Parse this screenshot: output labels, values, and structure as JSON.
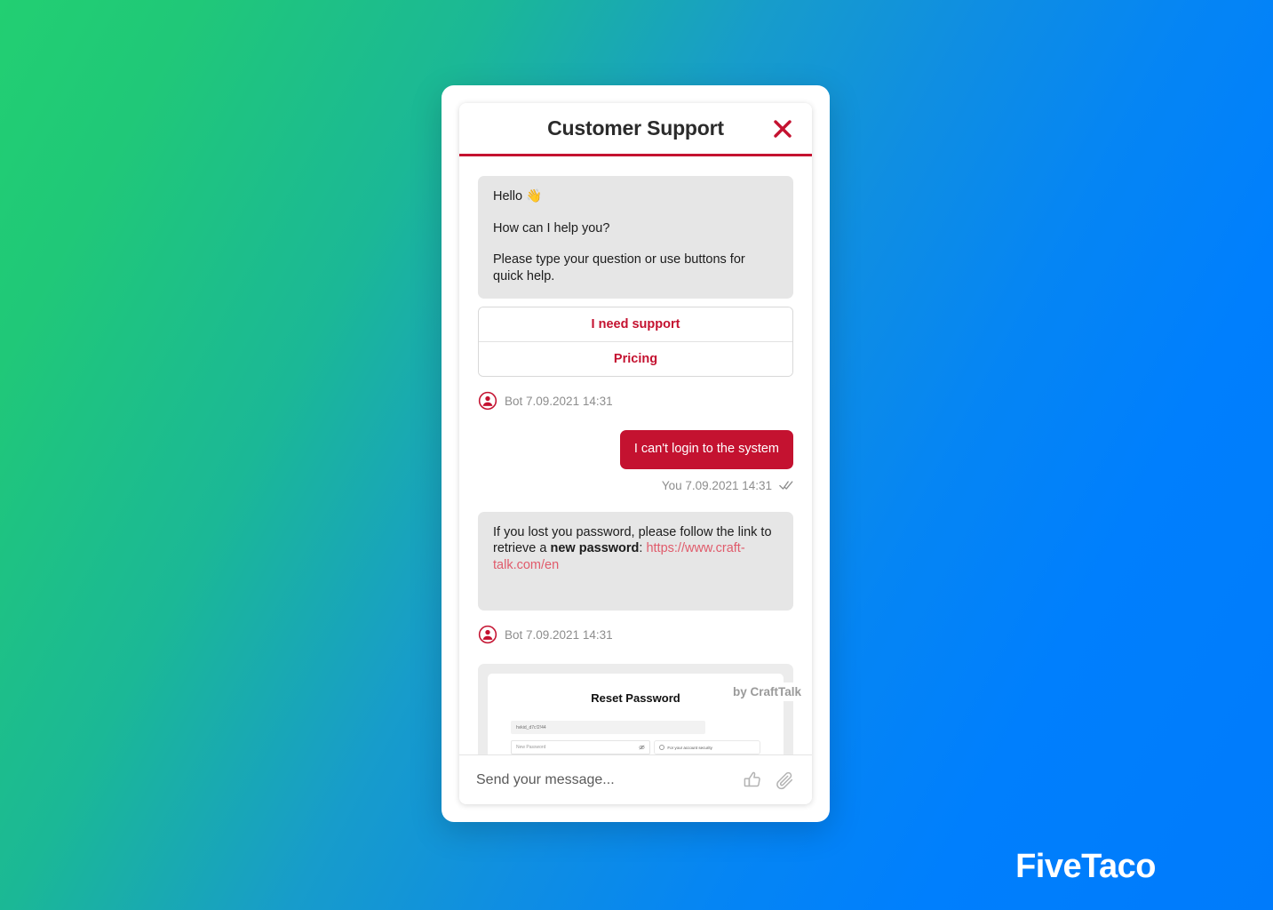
{
  "background": {
    "gradient_start": "#22cf72",
    "gradient_mid": "#179ccb",
    "gradient_end": "#007bfb"
  },
  "brand": {
    "logo_text": "FiveTaco"
  },
  "widget": {
    "accent_color": "#c41230",
    "header": {
      "title": "Customer Support",
      "close_label": "close-icon"
    },
    "messages": [
      {
        "type": "bot",
        "lines": [
          "Hello 👋",
          "How can I help you?",
          "Please type your question or use buttons for quick help."
        ],
        "quick_replies": [
          "I need support",
          "Pricing"
        ],
        "meta": "Bot 7.09.2021 14:31"
      },
      {
        "type": "user",
        "text": "I can't login to the system",
        "meta": "You 7.09.2021 14:31",
        "status": "read"
      },
      {
        "type": "bot",
        "text_before": "If you lost you password, please follow the link to retrieve a ",
        "text_bold": "new password",
        "text_after": ": ",
        "link": "https://www.craft-talk.com/en",
        "meta": "Bot 7.09.2021 14:31"
      }
    ],
    "attachment_preview": {
      "title": "Reset Password",
      "field_value": "hvkid_d7c!2!44",
      "password_placeholder": "New Password",
      "tooltip": "For your account security"
    },
    "vendor_label": "by CraftTalk",
    "composer": {
      "placeholder": "Send your message...",
      "value": "",
      "thumb_icon": "thumbs-up-icon",
      "attach_icon": "paperclip-icon"
    }
  }
}
